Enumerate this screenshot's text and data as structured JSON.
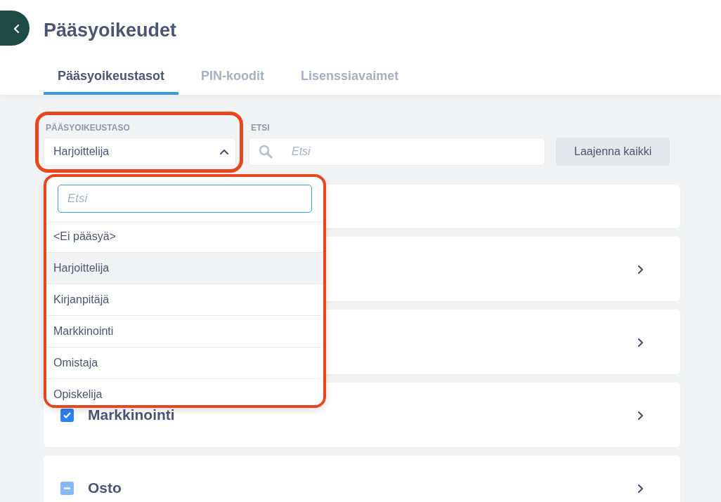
{
  "header": {
    "title": "Pääsyoikeudet"
  },
  "tabs": [
    {
      "label": "Pääsyoikeustasot",
      "selected": true
    },
    {
      "label": "PIN-koodit",
      "selected": false
    },
    {
      "label": "Lisenssiavaimet",
      "selected": false
    }
  ],
  "filters": {
    "level_label": "PÄÄSYOIKEUSTASO",
    "level_value": "Harjoittelija",
    "level_highlighted": true,
    "expanded": true,
    "search_label": "ETSI",
    "search_placeholder": "Etsi",
    "expand_button": "Laajenna kaikki"
  },
  "dropdown": {
    "highlighted": true,
    "search_placeholder": "Etsi",
    "options": [
      {
        "label": "<Ei pääsyä>",
        "selected": false
      },
      {
        "label": "Harjoittelija",
        "selected": true
      },
      {
        "label": "Kirjanpitäjä",
        "selected": false
      },
      {
        "label": "Markkinointi",
        "selected": false
      },
      {
        "label": "Omistaja",
        "selected": false
      },
      {
        "label": "Opiskelija",
        "selected": false
      }
    ]
  },
  "cards": [
    {
      "kind": "blank"
    },
    {
      "kind": "group"
    },
    {
      "kind": "group"
    },
    {
      "kind": "group",
      "title": "Markkinointi",
      "checked": true,
      "indeterminate": false
    },
    {
      "kind": "group",
      "title": "Osto",
      "checked": false,
      "indeterminate": true
    }
  ]
}
